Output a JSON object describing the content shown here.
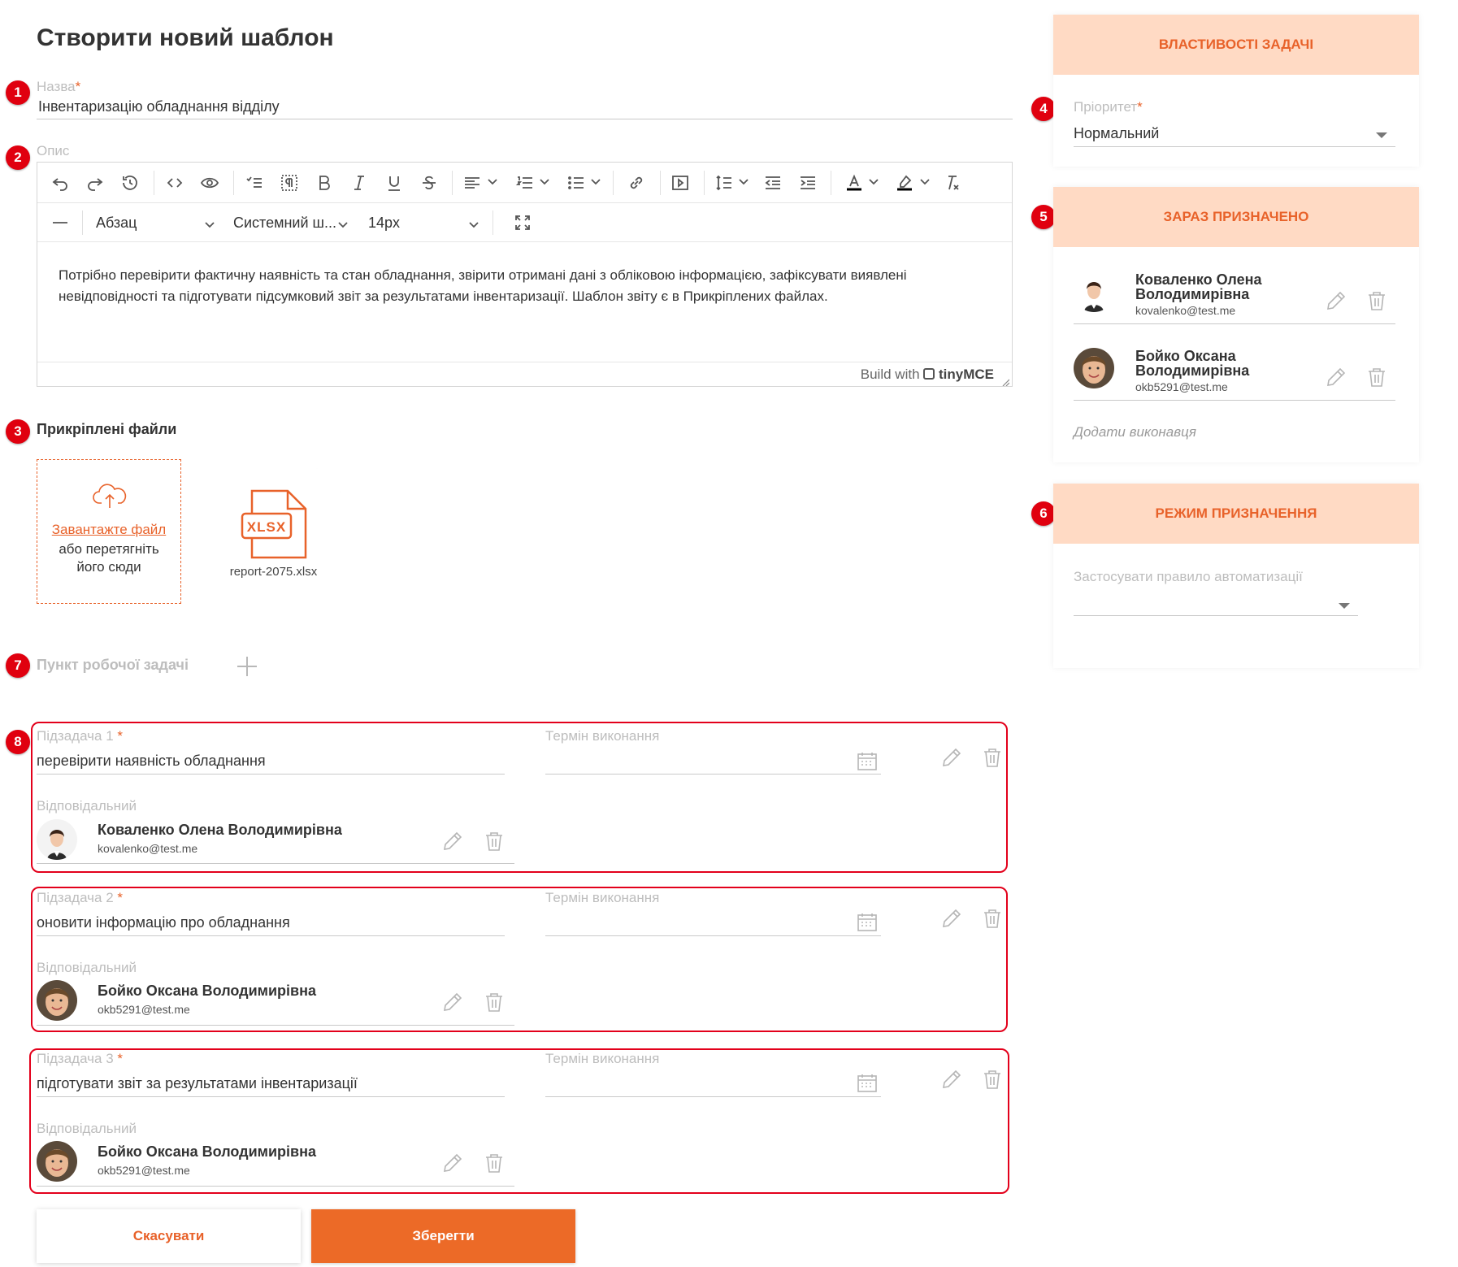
{
  "page": {
    "title": "Створити новий шаблон"
  },
  "badges": [
    "1",
    "2",
    "3",
    "4",
    "5",
    "6",
    "7",
    "8"
  ],
  "form": {
    "name_label": "Назва",
    "name_value": "Інвентаризацію обладнання відділу",
    "required_mark": "*",
    "description_label": "Опис"
  },
  "editor": {
    "block_format": "Абзац",
    "font_family": "Системний ш...",
    "font_size": "14px",
    "content": "Потрібно перевірити фактичну наявність та стан обладнання, звірити отримані дані з обліковою інформацією, зафіксувати виявлені невідповідності та підготувати підсумковий звіт за результатами інвентаризації. Шаблон звіту є в Прикріплених файлах.",
    "branding_prefix": "Build with",
    "branding_name": "tinyMCE"
  },
  "attachments": {
    "title": "Прикріплені файли",
    "upload_link": "Завантажте файл",
    "upload_hint": "або перетягніть його сюди",
    "files": [
      {
        "name": "report-2075.xlsx",
        "ext": "XLSX"
      }
    ]
  },
  "work_item": {
    "label": "Пункт робочої задачі"
  },
  "subtasks": {
    "deadline_label": "Термін виконання",
    "responsible_label": "Відповідальний",
    "items": [
      {
        "label": "Підзадача 1",
        "value": "перевірити наявність обладнання",
        "person": {
          "name": "Коваленко Олена Володимирівна",
          "email": "kovalenko@test.me"
        }
      },
      {
        "label": "Підзадача 2",
        "value": "оновити інформацію про обладнання",
        "person": {
          "name": "Бойко Оксана Володимирівна",
          "email": "okb5291@test.me"
        }
      },
      {
        "label": "Підзадача 3",
        "value": "підготувати звіт за результатами інвентаризації",
        "person": {
          "name": "Бойко Оксана Володимирівна",
          "email": "okb5291@test.me"
        }
      }
    ]
  },
  "actions": {
    "cancel": "Скасувати",
    "save": "Зберегти"
  },
  "properties": {
    "title": "ВЛАСТИВОСТІ ЗАДАЧІ",
    "priority_label": "Пріоритет",
    "priority_value": "Нормальний"
  },
  "assigned": {
    "title": "ЗАРАЗ ПРИЗНАЧЕНО",
    "people": [
      {
        "name_line1": "Коваленко Олена",
        "name_line2": "Володимирівна",
        "email": "kovalenko@test.me"
      },
      {
        "name_line1": "Бойко Оксана",
        "name_line2": "Володимирівна",
        "email": "okb5291@test.me"
      }
    ],
    "add_link": "Додати виконавця"
  },
  "assignment_mode": {
    "title": "РЕЖИМ ПРИЗНАЧЕННЯ",
    "rule_label": "Застосувати правило автоматизації",
    "rule_value": ""
  },
  "colors": {
    "accent": "#e8622a",
    "header_bg": "#ffdac4",
    "badge": "#e0000f",
    "highlight_border": "#e3001b"
  }
}
